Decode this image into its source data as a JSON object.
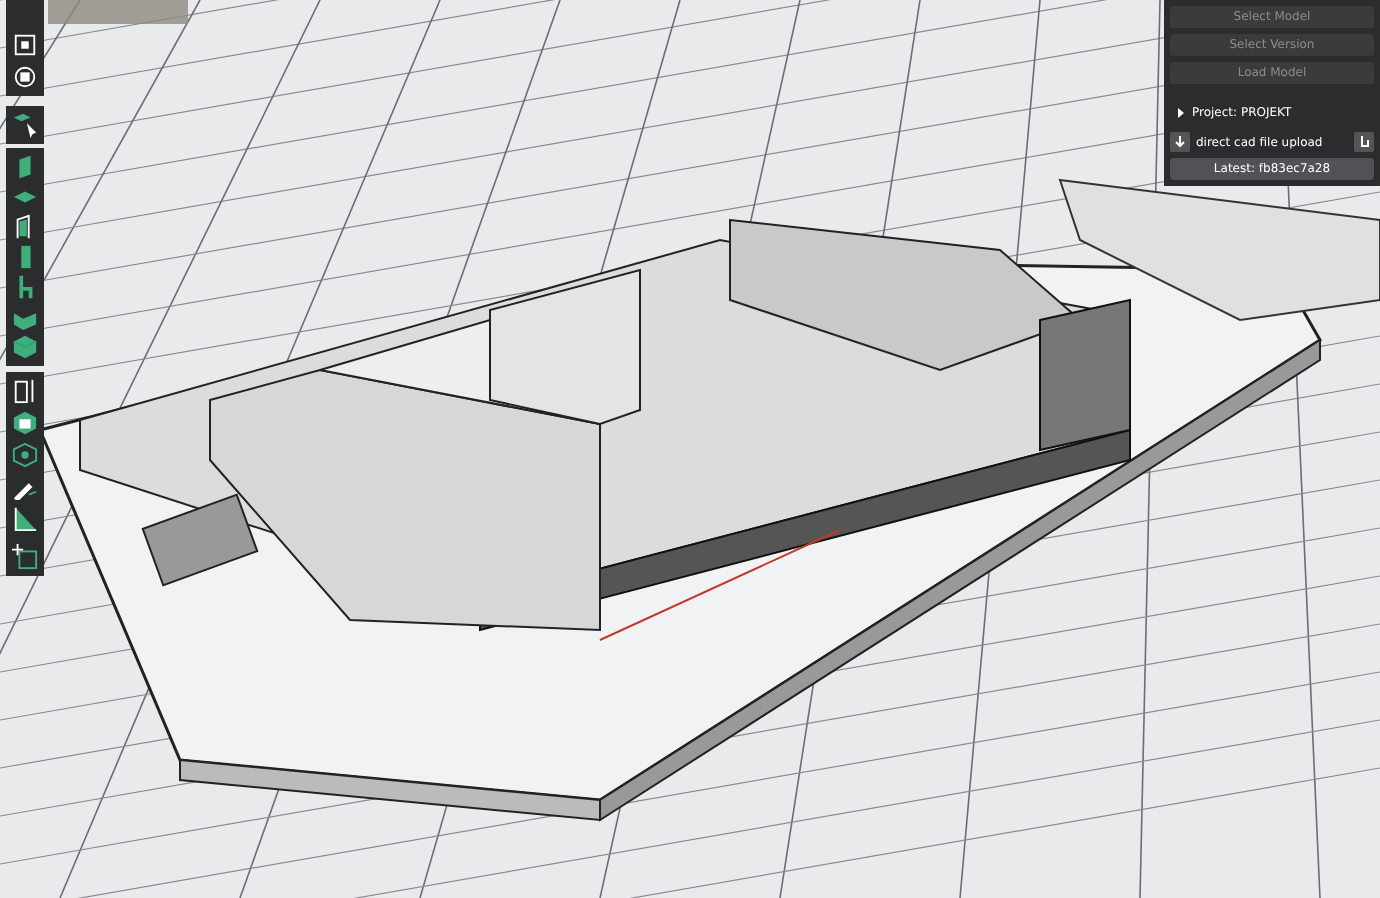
{
  "model_panel": {
    "buttons": [
      {
        "label": "Select Model",
        "disabled": true
      },
      {
        "label": "Select Version",
        "disabled": true
      },
      {
        "label": "Load Model",
        "disabled": true
      }
    ],
    "project": {
      "label": "Project: PROJEKT",
      "expanded": false
    },
    "upload": {
      "label": "direct cad file upload"
    },
    "latest": {
      "label": "Latest: fb83ec7a28"
    }
  }
}
